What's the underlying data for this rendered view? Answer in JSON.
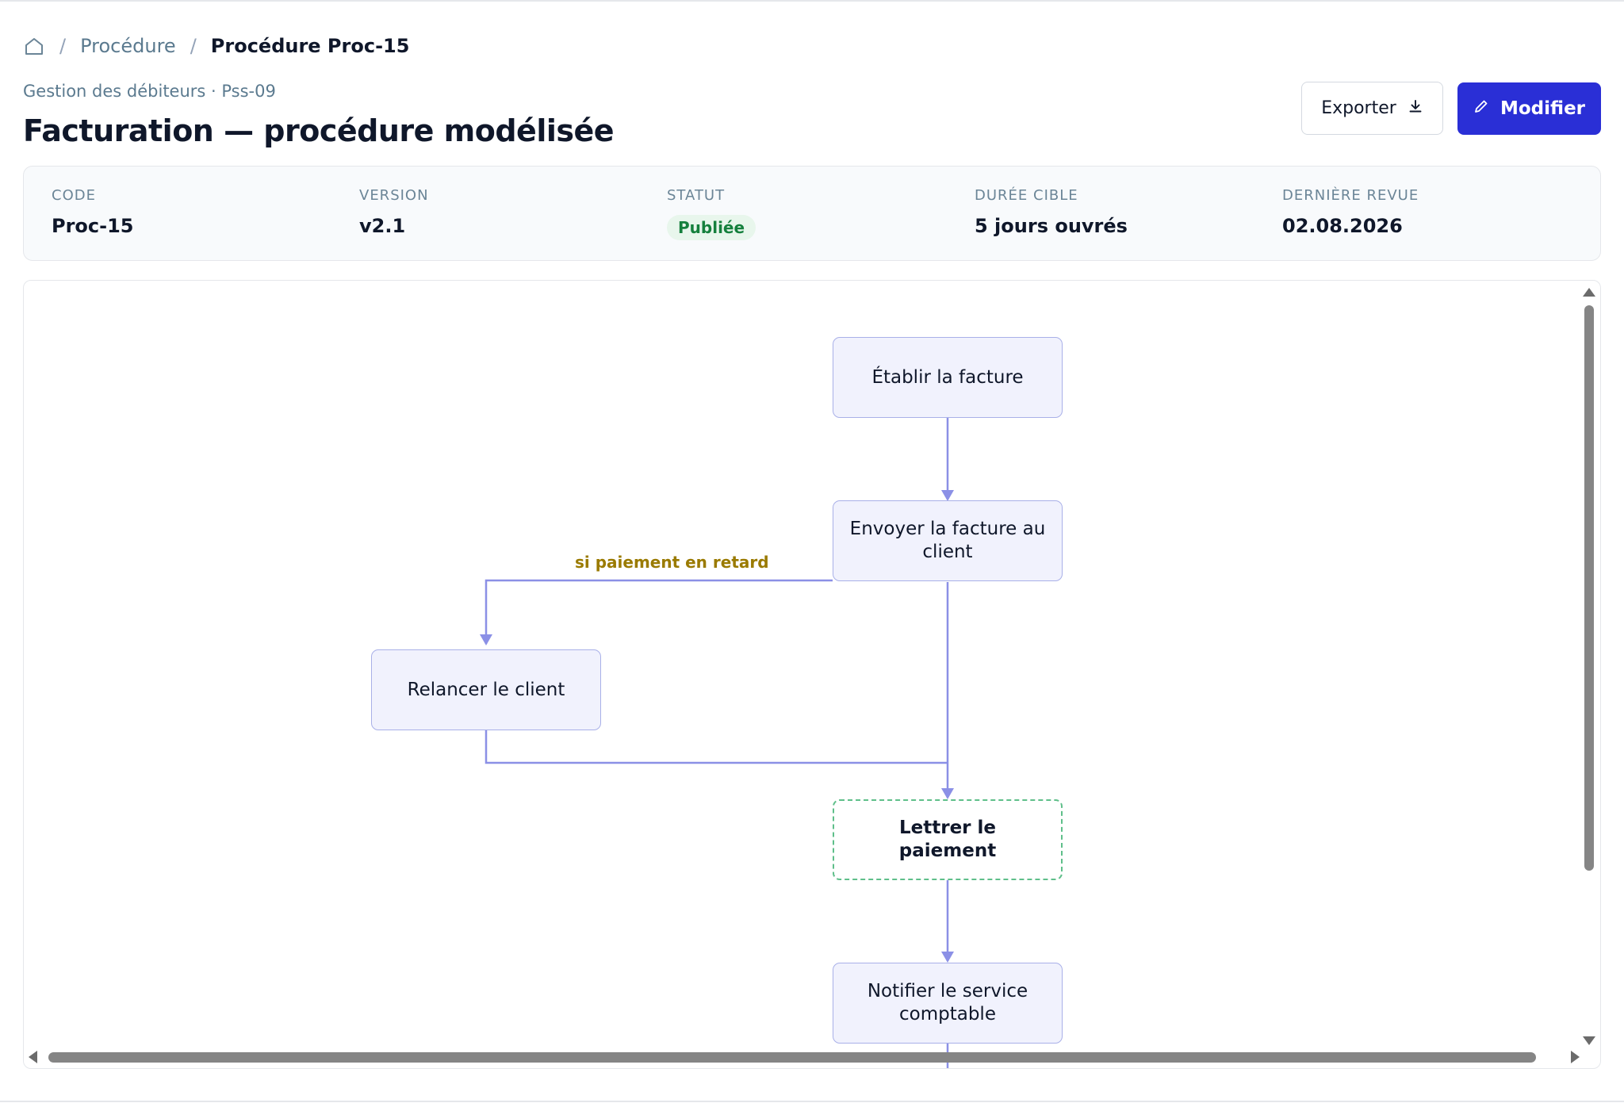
{
  "breadcrumb": {
    "home_icon": "home-icon",
    "separator": "/",
    "items": [
      "Procédure",
      "Procédure Proc-15"
    ]
  },
  "header": {
    "subtitle": "Gestion des débiteurs · Pss-09",
    "title": "Facturation — procédure modélisée"
  },
  "actions": {
    "export_label": "Exporter",
    "export_icon": "download-icon",
    "modify_label": "Modifier",
    "modify_icon": "pencil-icon"
  },
  "meta": {
    "code": {
      "label": "Code",
      "value": "Proc-15"
    },
    "version": {
      "label": "Version",
      "value": "v2.1"
    },
    "status": {
      "label": "Statut",
      "value": "Publiée",
      "color": "#15803d"
    },
    "duration": {
      "label": "Durée cible",
      "value": "5 jours ouvrés"
    },
    "review": {
      "label": "Dernière revue",
      "value": "02.08.2026"
    }
  },
  "flow": {
    "nodes": [
      {
        "id": "n1",
        "label": "Établir la facture"
      },
      {
        "id": "n2",
        "label": "Envoyer la facture au client"
      },
      {
        "id": "n3",
        "label": "Relancer le client"
      },
      {
        "id": "n4",
        "label": "Lettrer le paiement",
        "style": "dashed"
      },
      {
        "id": "n5",
        "label": "Notifier le service comptable"
      }
    ],
    "edges": [
      {
        "from": "n1",
        "to": "n2"
      },
      {
        "from": "n2",
        "to": "n3",
        "label": "si paiement en retard"
      },
      {
        "from": "n2",
        "to": "n4"
      },
      {
        "from": "n3",
        "to": "n4"
      },
      {
        "from": "n4",
        "to": "n5"
      }
    ],
    "colors": {
      "edge": "#8b90e6",
      "node_border": "#a9b0e8",
      "node_fill": "#f1f2fd",
      "dashed_border": "#5fbf8a",
      "edge_label": "#9a7a00"
    }
  },
  "colors": {
    "primary": "#2a2fd6",
    "muted_text": "#5b7a8f"
  }
}
